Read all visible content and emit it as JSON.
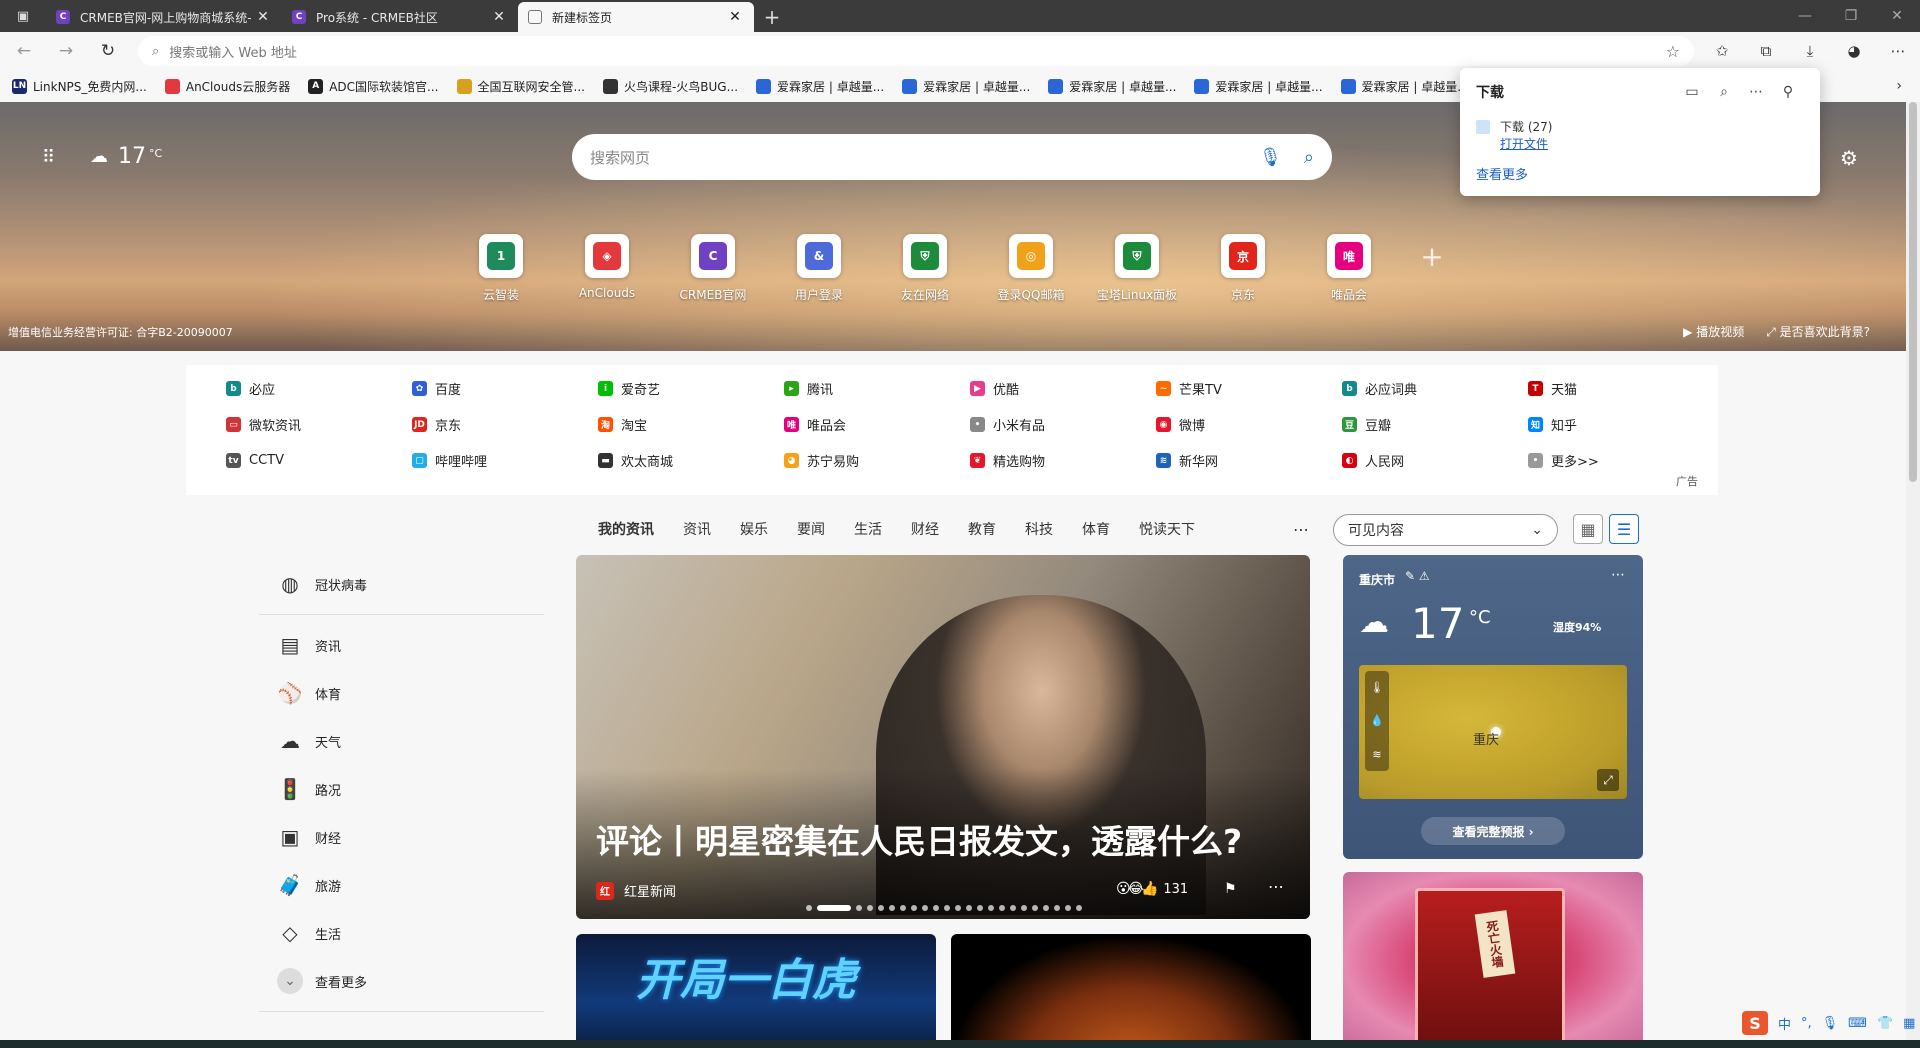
{
  "tabs": [
    {
      "title": "CRMEB官网-网上购物商城系统-",
      "favicon_color": "#6f42c1",
      "favicon_glyph": "C"
    },
    {
      "title": "Pro系统 - CRMEB社区",
      "favicon_color": "#6f42c1",
      "favicon_glyph": "C"
    },
    {
      "title": "新建标签页",
      "favicon_color": "#777777",
      "favicon_glyph": ""
    }
  ],
  "address": {
    "placeholder": "搜索或输入 Web 地址"
  },
  "bookmarks": [
    {
      "label": "LinkNPS_免费内网...",
      "color": "#1a2a6c",
      "glyph": "LN"
    },
    {
      "label": "AnClouds云服务器",
      "color": "#e4393c",
      "glyph": ""
    },
    {
      "label": "ADC国际软装馆官...",
      "color": "#222222",
      "glyph": "A"
    },
    {
      "label": "全国互联网安全管...",
      "color": "#d6a21d",
      "glyph": ""
    },
    {
      "label": "火鸟课程-火鸟BUG...",
      "color": "#333333",
      "glyph": ""
    },
    {
      "label": "爱霖家居 | 卓越量...",
      "color": "#2a66d6",
      "glyph": ""
    },
    {
      "label": "爱霖家居 | 卓越量...",
      "color": "#2a66d6",
      "glyph": ""
    },
    {
      "label": "爱霖家居 | 卓越量...",
      "color": "#2a66d6",
      "glyph": ""
    },
    {
      "label": "爱霖家居 | 卓越量...",
      "color": "#2a66d6",
      "glyph": ""
    },
    {
      "label": "爱霖家居 | 卓越量...",
      "color": "#2a66d6",
      "glyph": ""
    }
  ],
  "downloads": {
    "title": "下载",
    "item_name": "下载 (27)",
    "open_file": "打开文件",
    "see_more": "查看更多"
  },
  "hero": {
    "temp": "17",
    "unit": "°C",
    "search_placeholder": "搜索网页",
    "license": "增值电信业务经营许可证: 合字B2-20090007",
    "play_video": "▶  播放视频",
    "like_bg": "⤢  是否喜欢此背景?"
  },
  "quicklinks": [
    {
      "label": "云智装",
      "color": "#1f8a5b",
      "glyph": "1"
    },
    {
      "label": "AnClouds",
      "color": "#e4393c",
      "glyph": "◈"
    },
    {
      "label": "CRMEB官网",
      "color": "#6f42c1",
      "glyph": "C"
    },
    {
      "label": "用户登录",
      "color": "#4d6bd8",
      "glyph": "&"
    },
    {
      "label": "友在网络",
      "color": "#1e8a3c",
      "glyph": "⛨"
    },
    {
      "label": "登录QQ邮箱",
      "color": "#f2a21a",
      "glyph": "◎"
    },
    {
      "label": "宝塔Linux面板",
      "color": "#1e8a3c",
      "glyph": "⛨"
    },
    {
      "label": "京东",
      "color": "#e1251b",
      "glyph": "京"
    },
    {
      "label": "唯品会",
      "color": "#e4007f",
      "glyph": "唯"
    }
  ],
  "sitelinks": [
    {
      "label": "必应",
      "color": "#138a8a",
      "glyph": "b"
    },
    {
      "label": "百度",
      "color": "#2f5fd8",
      "glyph": "✿"
    },
    {
      "label": "爱奇艺",
      "color": "#00be06",
      "glyph": "i"
    },
    {
      "label": "腾讯",
      "color": "#2aa515",
      "glyph": "▸"
    },
    {
      "label": "优酷",
      "color": "#e63d8c",
      "glyph": "▶"
    },
    {
      "label": "芒果TV",
      "color": "#ff6a00",
      "glyph": "~"
    },
    {
      "label": "必应词典",
      "color": "#138a8a",
      "glyph": "b"
    },
    {
      "label": "天猫",
      "color": "#c40000",
      "glyph": "T"
    },
    {
      "label": "微软资讯",
      "color": "#d13438",
      "glyph": "▭"
    },
    {
      "label": "京东",
      "color": "#e1251b",
      "glyph": "JD"
    },
    {
      "label": "淘宝",
      "color": "#ff5000",
      "glyph": "淘"
    },
    {
      "label": "唯品会",
      "color": "#e4007f",
      "glyph": "唯"
    },
    {
      "label": "小米有品",
      "color": "#888888",
      "glyph": "•"
    },
    {
      "label": "微博",
      "color": "#e6162d",
      "glyph": "◉"
    },
    {
      "label": "豆瓣",
      "color": "#2e963d",
      "glyph": "豆"
    },
    {
      "label": "知乎",
      "color": "#0084ff",
      "glyph": "知"
    },
    {
      "label": "CCTV",
      "color": "#555555",
      "glyph": "tv"
    },
    {
      "label": "哔哩哔哩",
      "color": "#23ade5",
      "glyph": "▢"
    },
    {
      "label": "欢太商城",
      "color": "#333333",
      "glyph": "▬"
    },
    {
      "label": "苏宁易购",
      "color": "#f7a11a",
      "glyph": "◕"
    },
    {
      "label": "精选购物",
      "color": "#e6162d",
      "glyph": "❦"
    },
    {
      "label": "新华网",
      "color": "#1f63b8",
      "glyph": "≋"
    },
    {
      "label": "人民网",
      "color": "#d7000f",
      "glyph": "◐"
    },
    {
      "label": "更多>>",
      "color": "#999999",
      "glyph": "•"
    }
  ],
  "ad_label": "广告",
  "left_nav": {
    "top": {
      "label": "冠状病毒",
      "icon": "globe-icon",
      "glyph": "🌐"
    },
    "items": [
      {
        "label": "资讯",
        "icon": "news-icon",
        "glyph": "▤",
        "name": "news"
      },
      {
        "label": "体育",
        "icon": "sport-ball-icon",
        "glyph": "⚾",
        "name": "sports"
      },
      {
        "label": "天气",
        "icon": "cloud-icon",
        "glyph": "☁",
        "name": "weather"
      },
      {
        "label": "路况",
        "icon": "traffic-light-icon",
        "glyph": "🚦",
        "name": "traffic"
      },
      {
        "label": "财经",
        "icon": "money-icon",
        "glyph": "▣",
        "name": "finance"
      },
      {
        "label": "旅游",
        "icon": "suitcase-icon",
        "glyph": "🧳",
        "name": "travel"
      },
      {
        "label": "生活",
        "icon": "diamond-icon",
        "glyph": "◇",
        "name": "life"
      }
    ],
    "more": "查看更多"
  },
  "feed_tabs": [
    "我的资讯",
    "资讯",
    "娱乐",
    "要闻",
    "生活",
    "财经",
    "教育",
    "科技",
    "体育",
    "悦读天下"
  ],
  "visible_select": "可见内容",
  "hero_card": {
    "headline": "评论丨明星密集在人民日报发文，透露什么?",
    "source": "红星新闻",
    "source_glyph": "红",
    "reactions": "131",
    "slides": 23,
    "current_slide": 1
  },
  "card_a_text": "开局一白虎",
  "weather": {
    "city": "重庆市",
    "temp": "17",
    "unit": "°C",
    "humidity": "湿度94%",
    "map_city": "重庆",
    "forecast_btn": "查看完整预报 ›"
  },
  "promo_tag": "死亡火墙",
  "ime": {
    "lang": "中",
    "punct": "°,"
  }
}
